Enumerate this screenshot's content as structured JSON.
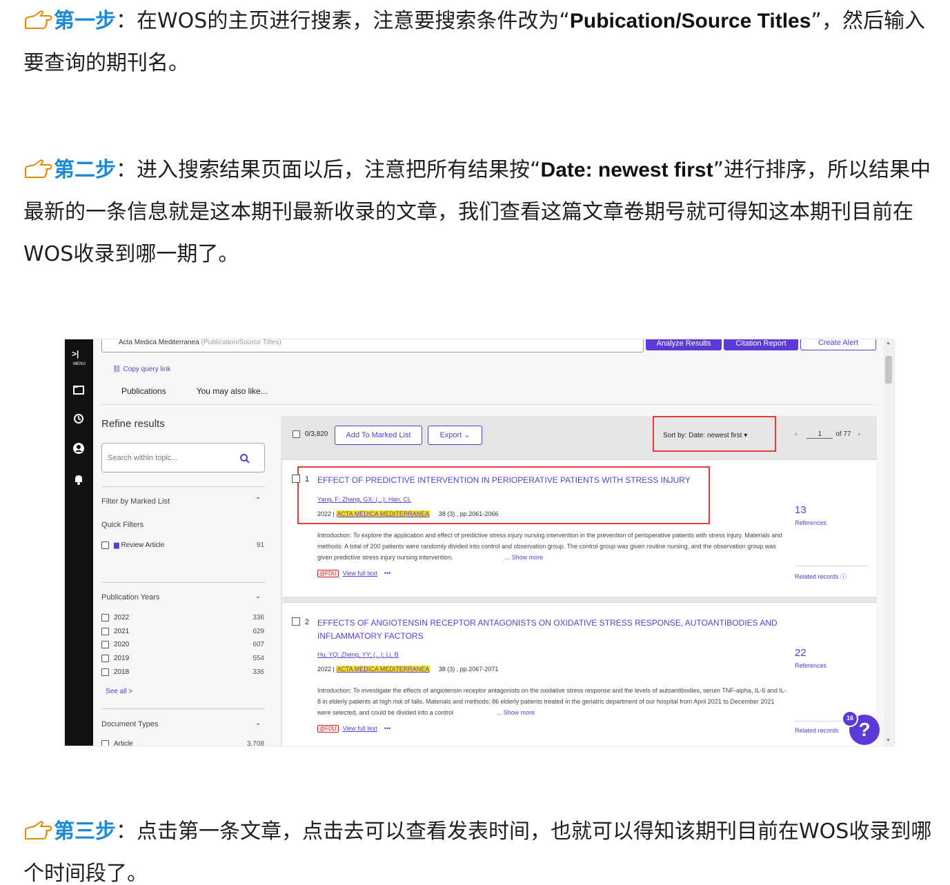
{
  "article": {
    "step1": {
      "label": "第一步",
      "sep": "：",
      "text_a": "在WOS的主页进行搜素，注意要搜索条件改为“",
      "bold": "Pubication/Source Titles",
      "text_b": "”，然后输入要查询的期刊名。"
    },
    "step2": {
      "label": "第二步",
      "sep": "：",
      "text_a": "进入搜索结果页面以后，注意把所有结果按“",
      "bold": "Date: newest first",
      "text_b": "”进行排序，所以结果中最新的一条信息就是这本期刊最新收录的文章，我们查看这篇文章卷期号就可得知这本期刊目前在WOS收录到哪一期了。"
    },
    "step3": {
      "label": "第三步",
      "sep": "：",
      "text": "点击第一条文章，点击去可以查看发表时间，也就可以得知该期刊目前在WOS收录到哪个时间段了。"
    }
  },
  "screenshot": {
    "rail": {
      "menu_label": "MENU",
      "expand_arrow": ">|",
      "icons": [
        "folder-icon",
        "history-icon",
        "account-icon",
        "bell-icon"
      ]
    },
    "search": {
      "query": "Acta Medica Mediterranea",
      "field": "(Publication/Source Titles)",
      "analyze": "Analyze Results",
      "citation": "Citation Report",
      "alert": "Create Alert"
    },
    "copy_query": "Copy query link",
    "tabs": [
      "Publications",
      "You may also like..."
    ],
    "sidebar": {
      "refine": "Refine results",
      "topic_placeholder": "Search within topic...",
      "filter_marked": "Filter by Marked List",
      "quick_filters": "Quick Filters",
      "review_article": "Review Article",
      "review_count": "91",
      "pub_years": "Publication Years",
      "years": [
        {
          "year": "2022",
          "count": "336"
        },
        {
          "year": "2021",
          "count": "629"
        },
        {
          "year": "2020",
          "count": "607"
        },
        {
          "year": "2019",
          "count": "554"
        },
        {
          "year": "2018",
          "count": "336"
        }
      ],
      "see_all": "See all >",
      "doc_types": "Document Types",
      "article_label": "Article",
      "article_count": "3,708"
    },
    "toolbar": {
      "selected": "0/3,820",
      "add_marked": "Add To Marked List",
      "export": "Export ⌄",
      "sort": "Sort by: Date: newest first",
      "page": "1",
      "of_pages": "of 77"
    },
    "results": [
      {
        "num": "1",
        "title": "EFFECT OF PREDICTIVE INTERVENTION IN PERIOPERATIVE PATIENTS WITH STRESS INJURY",
        "authors": "Yang, F; Zhang, GX; (...); Han, CL",
        "year": "2022 |",
        "journal": "ACTA MEDICA MEDITERRANEA",
        "volume": "38 (3) , pp.2061-2066",
        "abstract": "Introduction: To explore the application and effect of predictive stress injury nursing intervention in the prevention of perioperative patients with stress injury. Materials and methods: A total of 200 patients were randomly divided into control and observation group. The control group was given routine nursing, and the observation group was given predictive stress injury nursing intervention.",
        "show_more": "... Show more",
        "fdu": "@FDU",
        "full_text": "View full text",
        "more": "•••",
        "refs": "13",
        "refs_label": "References",
        "related": "Related records ⓘ"
      },
      {
        "num": "2",
        "title": "EFFECTS OF ANGIOTENSIN RECEPTOR ANTAGONISTS ON OXIDATIVE STRESS RESPONSE, AUTOANTIBODIES AND INFLAMMATORY FACTORS",
        "authors": "Hu, YQ; Zheng, YY; (...); Li, B",
        "year": "2022 |",
        "journal": "ACTA MEDICA MEDITERRANEA",
        "volume": "38 (3) , pp.2067-2071",
        "abstract": "Introduction: To investigate the effects of angiotensin receptor antagonists on the oxidative stress response and the levels of autoantibodies, serum TNF-alpha, IL-6 and IL-8 in elderly patients at high risk of falls. Materials and methods: 86 elderly patients treated in the geriatric department of our hospital from April 2021 to December 2021 were selected, and could be divided into a control",
        "show_more": "... Show more",
        "fdu": "@FDU",
        "full_text": "View full text",
        "more": "•••",
        "refs": "22",
        "refs_label": "References",
        "related": "Related records"
      }
    ],
    "help": {
      "badge": "16",
      "symbol": "?"
    }
  },
  "colors": {
    "step": "#1a8ad4",
    "accent": "#5c3ad6",
    "highlight_box": "#e23b3b",
    "journal_highlight": "#f5e21c"
  }
}
